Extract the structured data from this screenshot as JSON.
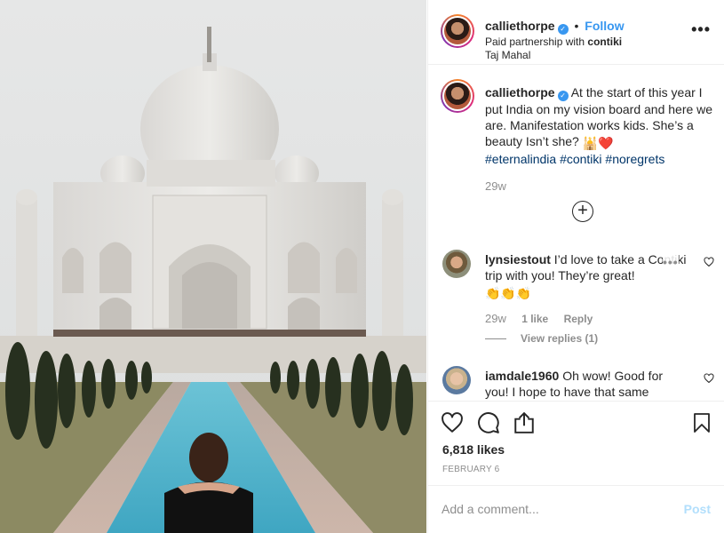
{
  "photo": {
    "alt": "Taj Mahal photo"
  },
  "header": {
    "username": "calliethorpe",
    "separator": "•",
    "follow_label": "Follow",
    "partnership_prefix": "Paid partnership with",
    "partner": "contiki",
    "location": "Taj Mahal",
    "more_label": "•••"
  },
  "caption": {
    "username": "calliethorpe",
    "text": "At the start of this year I put India on my vision board and here we are. Manifestation works kids. She’s a beauty Isn’t she?",
    "emojis": "🕌❤️",
    "hashtags": [
      "#eternalindia",
      "#contiki",
      "#noregrets"
    ],
    "time": "29w"
  },
  "comments": [
    {
      "username": "lynsiestout",
      "text": "I’d love to take a Contiki trip with you! They’re great!",
      "emojis": "👏👏👏",
      "time": "29w",
      "likes": "1 like",
      "reply_label": "Reply",
      "view_replies": "View replies (1)",
      "more_label": "•••"
    },
    {
      "username": "iamdale1960",
      "text": "Oh wow! Good for you! I hope to have that same"
    }
  ],
  "actions": {
    "likes": "6,818 likes",
    "date": "FEBRUARY 6"
  },
  "comment_box": {
    "placeholder": "Add a comment...",
    "post_label": "Post"
  },
  "colors": {
    "accent": "#3897f0",
    "hashtag": "#003569",
    "muted": "#8e8e8e",
    "post_disabled": "#b2dffc"
  },
  "icons": {
    "verified": "verified-badge-icon",
    "load_more": "plus-circle-icon",
    "like": "heart-icon",
    "comment": "comment-bubble-icon",
    "share": "share-icon",
    "save": "bookmark-icon"
  }
}
